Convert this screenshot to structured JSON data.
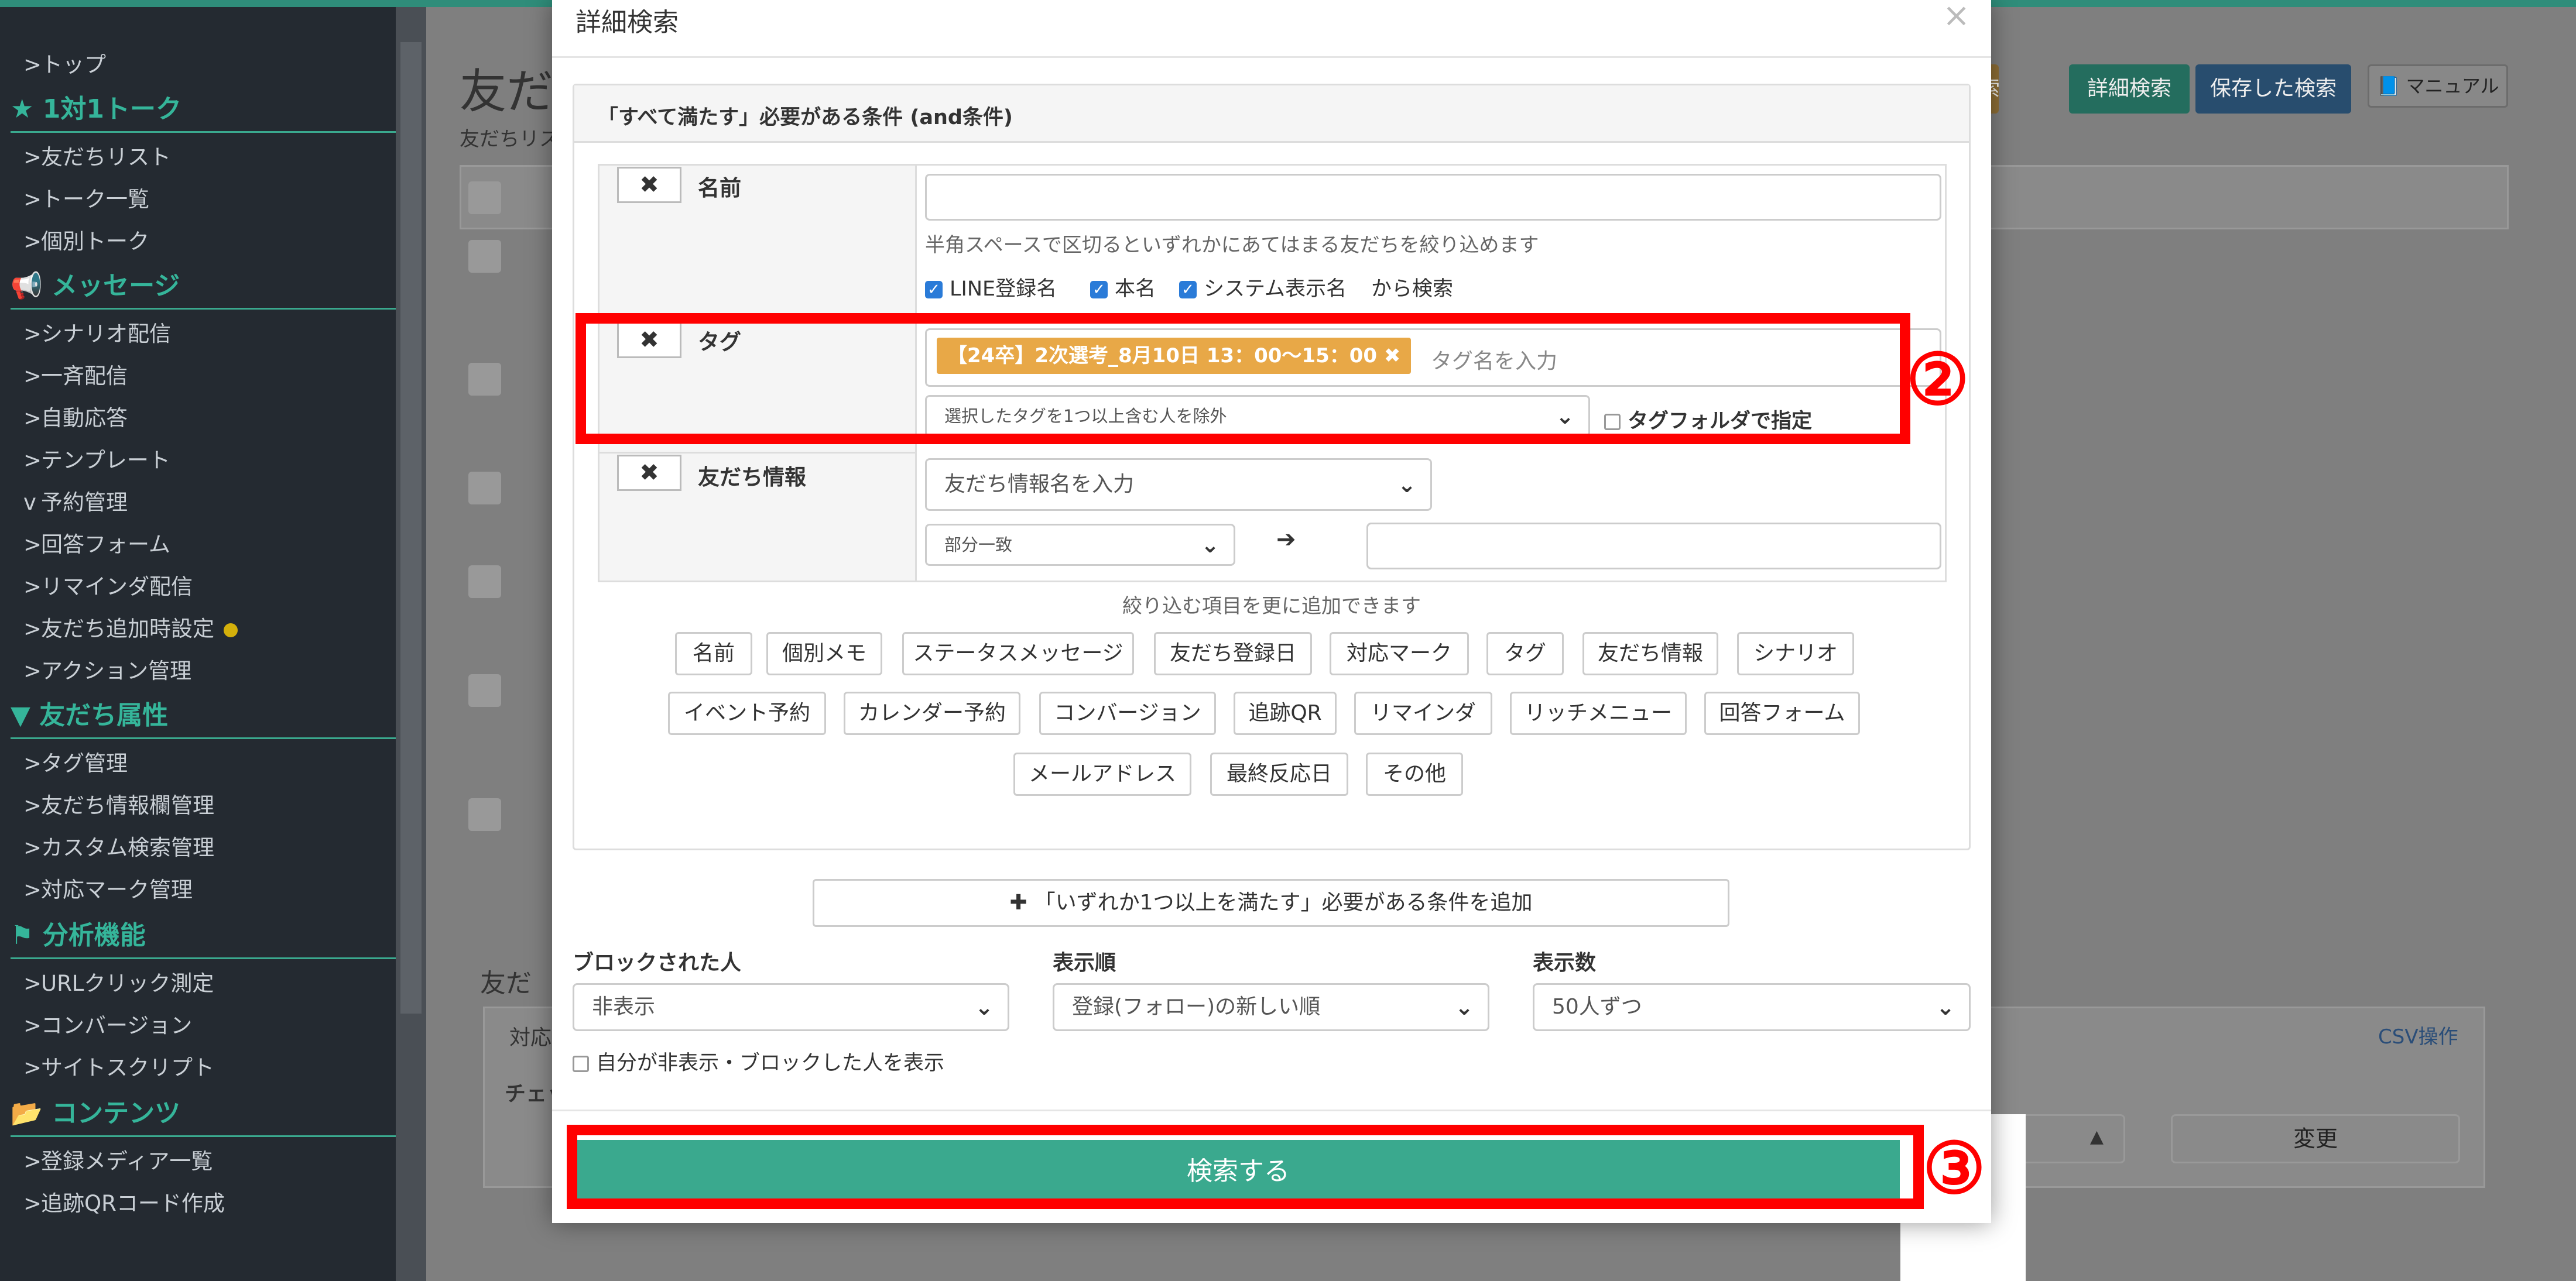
{
  "sidebar": {
    "items": [
      {
        "label": "トップ",
        "chev": ">"
      },
      {
        "label": "友だちリスト",
        "chev": ">"
      },
      {
        "label": "トーク一覧",
        "chev": ">"
      },
      {
        "label": "個別トーク",
        "chev": ">"
      },
      {
        "label": "シナリオ配信",
        "chev": ">"
      },
      {
        "label": "一斉配信",
        "chev": ">"
      },
      {
        "label": "自動応答",
        "chev": ">"
      },
      {
        "label": "テンプレート",
        "chev": ">"
      },
      {
        "label": "予約管理",
        "chev": "v"
      },
      {
        "label": "回答フォーム",
        "chev": ">"
      },
      {
        "label": "リマインダ配信",
        "chev": ">"
      },
      {
        "label": "友だち追加時設定",
        "chev": ">"
      },
      {
        "label": "アクション管理",
        "chev": ">"
      },
      {
        "label": "タグ管理",
        "chev": ">"
      },
      {
        "label": "友だち情報欄管理",
        "chev": ">"
      },
      {
        "label": "カスタム検索管理",
        "chev": ">"
      },
      {
        "label": "対応マーク管理",
        "chev": ">"
      },
      {
        "label": "URLクリック測定",
        "chev": ">"
      },
      {
        "label": "コンバージョン",
        "chev": ">"
      },
      {
        "label": "サイトスクリプト",
        "chev": ">"
      },
      {
        "label": "登録メディア一覧",
        "chev": ">"
      },
      {
        "label": "追跡QRコード作成",
        "chev": ">"
      }
    ],
    "headings": [
      {
        "label": "★ 1対1トーク"
      },
      {
        "label": "📢 メッセージ"
      },
      {
        "label": "▼ 友だち属性"
      },
      {
        "label": "⚑ 分析機能"
      },
      {
        "label": "📂 コンテンツ"
      }
    ]
  },
  "background": {
    "page_title": "友だ",
    "subtitle": "友だちリス",
    "btn_search": "索",
    "btn_detail_search": "詳細検索",
    "btn_saved_search": "保存した検索",
    "btn_manual": "📘 マニュアル",
    "lower_title": "友だ",
    "tab_label": "対応",
    "check_label": "チェッ",
    "csv_tab": "CSV操作",
    "change_button": "変更",
    "stepper": "▲"
  },
  "modal": {
    "title": "詳細検索",
    "close": "×",
    "panel_heading": "「すべて満たす」必要がある条件 (and条件)",
    "conditions": {
      "name": {
        "remove": "✖",
        "label": "名前",
        "value": "",
        "hint": "半角スペースで区切るといずれかにあてはまる友だちを絞り込めます",
        "checks": [
          "LINE登録名",
          "本名",
          "システム表示名"
        ],
        "suffix": "から検索"
      },
      "tag": {
        "remove": "✖",
        "label": "タグ",
        "chip": "【24卒】2次選考_8月10日 13：00〜15：00 ✖",
        "placeholder": "タグ名を入力",
        "mode": "選択したタグを1つ以上含む人を除外",
        "folder_label": "タグフォルダで指定"
      },
      "friend_info": {
        "remove": "✖",
        "label": "友だち情報",
        "field_placeholder": "友だち情報名を入力",
        "match": "部分一致",
        "arrow": "➔",
        "value": ""
      }
    },
    "add_hint": "絞り込む項目を更に追加できます",
    "add_buttons": {
      "row1": [
        "名前",
        "個別メモ",
        "ステータスメッセージ",
        "友だち登録日",
        "対応マーク",
        "タグ",
        "友だち情報",
        "シナリオ"
      ],
      "row2": [
        "イベント予約",
        "カレンダー予約",
        "コンバージョン",
        "追跡QR",
        "リマインダ",
        "リッチメニュー",
        "回答フォーム"
      ],
      "row3": [
        "メールアドレス",
        "最終反応日",
        "その他"
      ]
    },
    "or_button": "「いずれか1つ以上を満たす」必要がある条件を追加",
    "or_icon": "✚",
    "blocked": {
      "label": "ブロックされた人",
      "value": "非表示"
    },
    "order": {
      "label": "表示順",
      "value": "登録(フォロー)の新しい順"
    },
    "count": {
      "label": "表示数",
      "value": "50人ずつ"
    },
    "show_hidden": "自分が非表示・ブロックした人を表示",
    "search_button": "検索する"
  },
  "annotations": {
    "step2": "②",
    "step3": "③"
  },
  "colors": {
    "sidebar_bg": "#242a31",
    "accent": "#3aa98e",
    "highlight": "#ff0000",
    "tag_chip": "#e8a847",
    "checkbox": "#2a7bd8"
  }
}
